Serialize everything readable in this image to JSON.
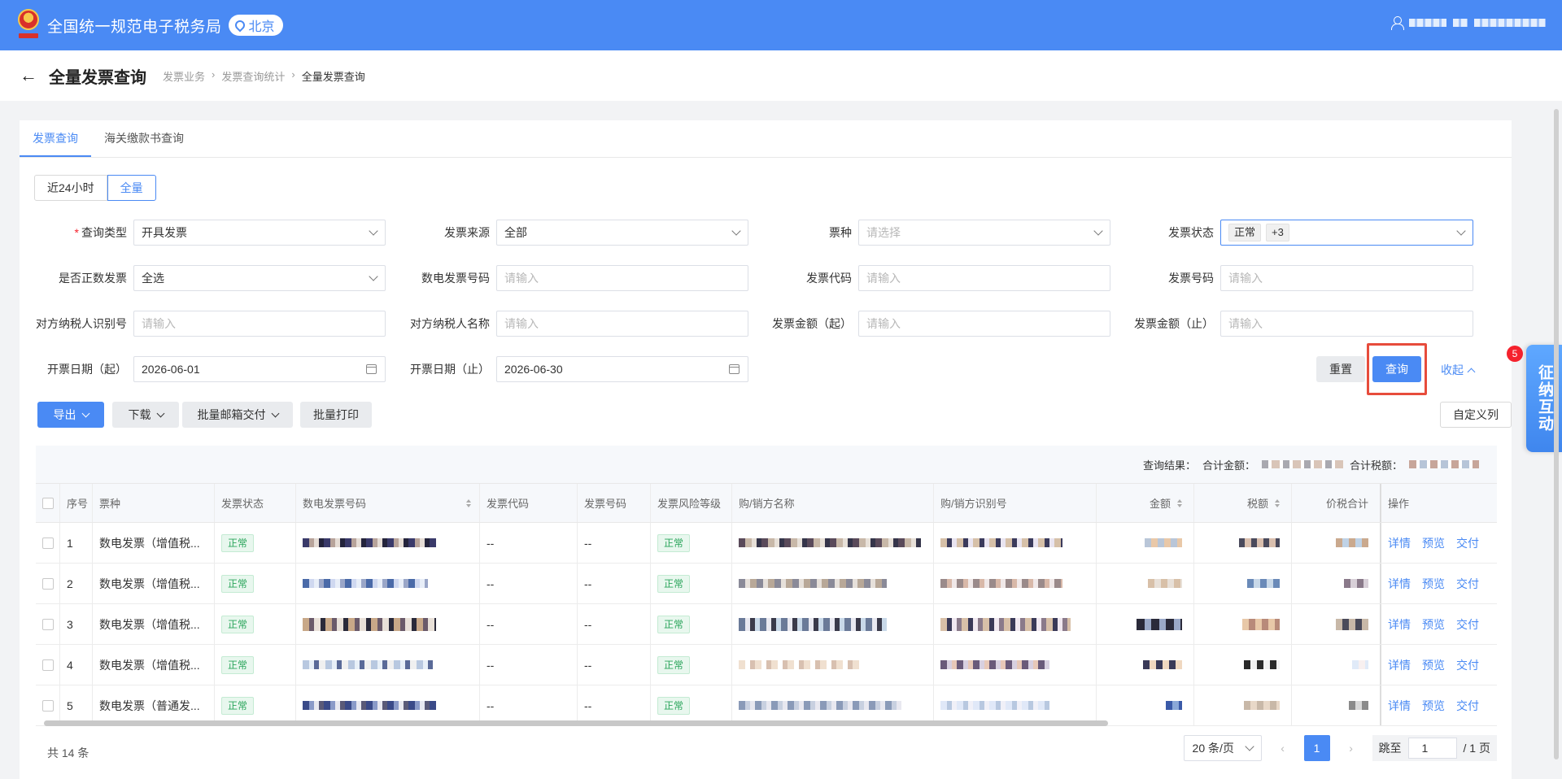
{
  "header": {
    "site_title": "全国统一规范电子税务局",
    "region": "北京"
  },
  "titlebar": {
    "title": "全量发票查询",
    "breadcrumb": [
      "发票业务",
      "发票查询统计",
      "全量发票查询"
    ]
  },
  "tabs": [
    "发票查询",
    "海关缴款书查询"
  ],
  "segment": {
    "options": [
      "近24小时",
      "全量"
    ],
    "selected": "全量"
  },
  "form": {
    "query_type": {
      "label": "查询类型",
      "value": "开具发票"
    },
    "invoice_source": {
      "label": "发票来源",
      "value": "全部"
    },
    "ticket_type": {
      "label": "票种",
      "placeholder": "请选择"
    },
    "invoice_status": {
      "label": "发票状态",
      "tag": "正常",
      "more": "+3"
    },
    "is_positive": {
      "label": "是否正数发票",
      "value": "全选"
    },
    "digital_no": {
      "label": "数电发票号码",
      "placeholder": "请输入"
    },
    "invoice_code": {
      "label": "发票代码",
      "placeholder": "请输入"
    },
    "invoice_no": {
      "label": "发票号码",
      "placeholder": "请输入"
    },
    "counterparty_id": {
      "label": "对方纳税人识别号",
      "placeholder": "请输入"
    },
    "counterparty_name": {
      "label": "对方纳税人名称",
      "placeholder": "请输入"
    },
    "amount_from": {
      "label": "发票金额（起）",
      "placeholder": "请输入"
    },
    "amount_to": {
      "label": "发票金额（止）",
      "placeholder": "请输入"
    },
    "date_from": {
      "label": "开票日期（起）",
      "value": "2026-06-01"
    },
    "date_to": {
      "label": "开票日期（止）",
      "value": "2026-06-30"
    }
  },
  "actions": {
    "reset": "重置",
    "query": "查询",
    "collapse": "收起",
    "export": "导出",
    "download": "下载",
    "batch_mail": "批量邮箱交付",
    "batch_print": "批量打印",
    "custom_columns": "自定义列"
  },
  "summary": {
    "result_label": "查询结果：",
    "total_amount_label": "合计金额：",
    "total_tax_label": "合计税额："
  },
  "table": {
    "columns": [
      "序号",
      "票种",
      "发票状态",
      "数电发票号码",
      "发票代码",
      "发票号码",
      "发票风险等级",
      "购/销方名称",
      "购/销方识别号",
      "金额",
      "税额",
      "价税合计",
      "操作"
    ],
    "rows": [
      {
        "no": "1",
        "type": "数电发票（增值税...",
        "status": "正常",
        "code": "--",
        "num": "--",
        "risk": "正常"
      },
      {
        "no": "2",
        "type": "数电发票（增值税...",
        "status": "正常",
        "code": "--",
        "num": "--",
        "risk": "正常"
      },
      {
        "no": "3",
        "type": "数电发票（增值税...",
        "status": "正常",
        "code": "--",
        "num": "--",
        "risk": "正常"
      },
      {
        "no": "4",
        "type": "数电发票（增值税...",
        "status": "正常",
        "code": "--",
        "num": "--",
        "risk": "正常"
      },
      {
        "no": "5",
        "type": "数电发票（普通发...",
        "status": "正常",
        "code": "--",
        "num": "--",
        "risk": "正常"
      }
    ],
    "row_actions": [
      "详情",
      "预览",
      "交付"
    ]
  },
  "pagination": {
    "total": "共 14 条",
    "page_size": "20 条/页",
    "current_page": "1",
    "jump_label": "跳至",
    "jump_value": "1",
    "page_total": "/ 1 页"
  },
  "float_widget": {
    "label": "征纳互动",
    "badge": "5"
  },
  "colors": {
    "primary": "#4a8af4",
    "highlight": "#e74c3c",
    "success": "#2aa55b"
  }
}
